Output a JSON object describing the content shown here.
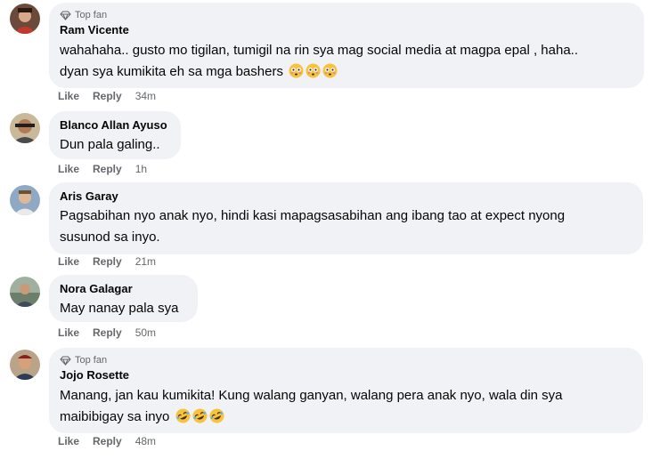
{
  "comments": [
    {
      "badge": "Top fan",
      "author": "Ram Vicente",
      "line1": "wahahaha.. gusto mo tigilan, tumigil na rin sya mag social media at magpa epal , haha..",
      "line2": "dyan sya kumikita eh sa mga bashers",
      "emoji": "flushed-face-icon",
      "emoji_count": 3,
      "like": "Like",
      "reply": "Reply",
      "time": "34m"
    },
    {
      "author": "Blanco Allan Ayuso",
      "line1": "Dun pala galing..",
      "like": "Like",
      "reply": "Reply",
      "time": "1h"
    },
    {
      "author": "Aris Garay",
      "line1": "Pagsabihan nyo anak nyo, hindi kasi mapagsasabihan ang ibang tao at expect nyong",
      "line2": "susunod sa inyo.",
      "like": "Like",
      "reply": "Reply",
      "time": "21m"
    },
    {
      "author": "Nora Galagar",
      "line1": "May nanay pala sya",
      "like": "Like",
      "reply": "Reply",
      "time": "50m"
    },
    {
      "badge": "Top fan",
      "author": "Jojo Rosette",
      "line1": "Manang, jan kau kumikita! Kung walang ganyan, walang pera anak nyo, wala din sya",
      "line2": "maibibigay sa inyo",
      "emoji": "rofl-face-icon",
      "emoji_count": 3,
      "like": "Like",
      "reply": "Reply",
      "time": "48m"
    }
  ],
  "colors": {
    "bubble_bg": "#f0f2f5",
    "secondary_text": "#65676b",
    "primary_text": "#050505"
  }
}
